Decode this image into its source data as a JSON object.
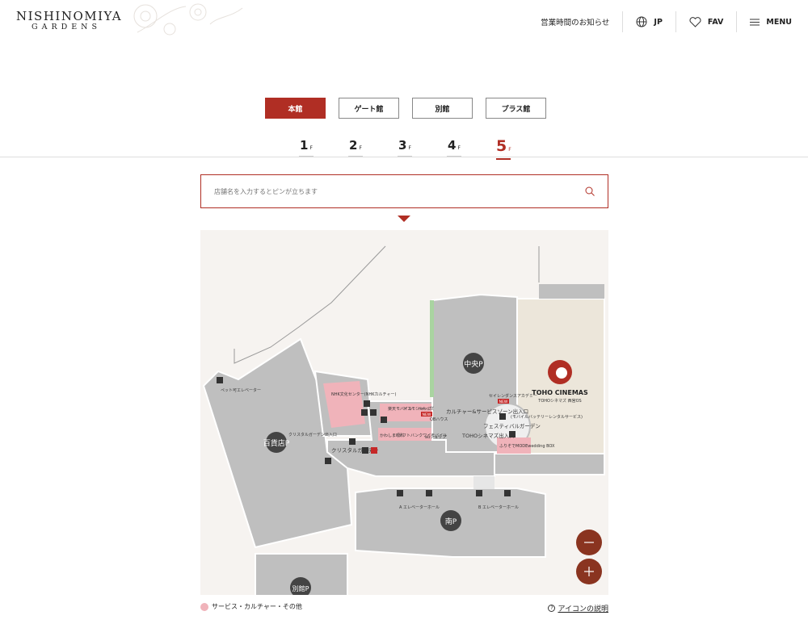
{
  "header": {
    "logo_main": "NISHINOMIYA",
    "logo_sub": "GARDENS",
    "notice": "営業時間のお知らせ",
    "lang": "JP",
    "fav": "FAV",
    "menu": "MENU"
  },
  "buildings": [
    {
      "label": "本館",
      "active": true
    },
    {
      "label": "ゲート館",
      "active": false
    },
    {
      "label": "別館",
      "active": false
    },
    {
      "label": "プラス館",
      "active": false
    }
  ],
  "floors": [
    {
      "num": "1",
      "unit": "F"
    },
    {
      "num": "2",
      "unit": "F"
    },
    {
      "num": "3",
      "unit": "F"
    },
    {
      "num": "4",
      "unit": "F"
    },
    {
      "num": "5",
      "unit": "F"
    }
  ],
  "active_floor": "5",
  "search": {
    "placeholder": "店舗名を入力するとピンが立ちます"
  },
  "map": {
    "labels": {
      "pet_elevator": "ペット可エレベーター",
      "dept_parking": "百貨店P",
      "crystal_garden_entrance": "クリスタルガーデン出入口",
      "crystal_garden": "クリスタルガーデン",
      "nhk": "NHK文化センター(NHKカルチャー)",
      "rakuten": "楽天モバイル",
      "docomo": "ドコモショップ",
      "dr_kids": "ドキッズ",
      "new1": "NEW",
      "qb": "QBハウス",
      "kawashima": "かわしま眼科",
      "softbank": "ソフトバンクワイモバイル",
      "au": "auショップ",
      "culture_zone": "カルチャー&サービスゾーン出入口",
      "central_parking": "中央P",
      "seiren": "セイレンダンスアカデミー",
      "new2": "NEW",
      "toho_cinemas": "TOHO CINEMAS",
      "toho_sub": "TOHOシネマズ 西宮OS",
      "toho_entrance": "TOHOシネマズ出入口",
      "festival": "フェスティバルガーデン",
      "rental": "(モバイルバッテリーレンタルサービス)",
      "furisode": "ふりそでMODEwedding BOX",
      "elev_a": "A エレベーターホール",
      "elev_b": "B エレベーターホール",
      "south_parking": "南P",
      "annex_parking": "別館P"
    }
  },
  "legend": {
    "label": "サービス・カルチャー・その他"
  },
  "icon_help": "アイコンの説明",
  "colors": {
    "accent": "#b02e24",
    "service_pink": "#f0b3ba",
    "building_gray": "#bfbfbf",
    "zoom": "#8a3420"
  }
}
